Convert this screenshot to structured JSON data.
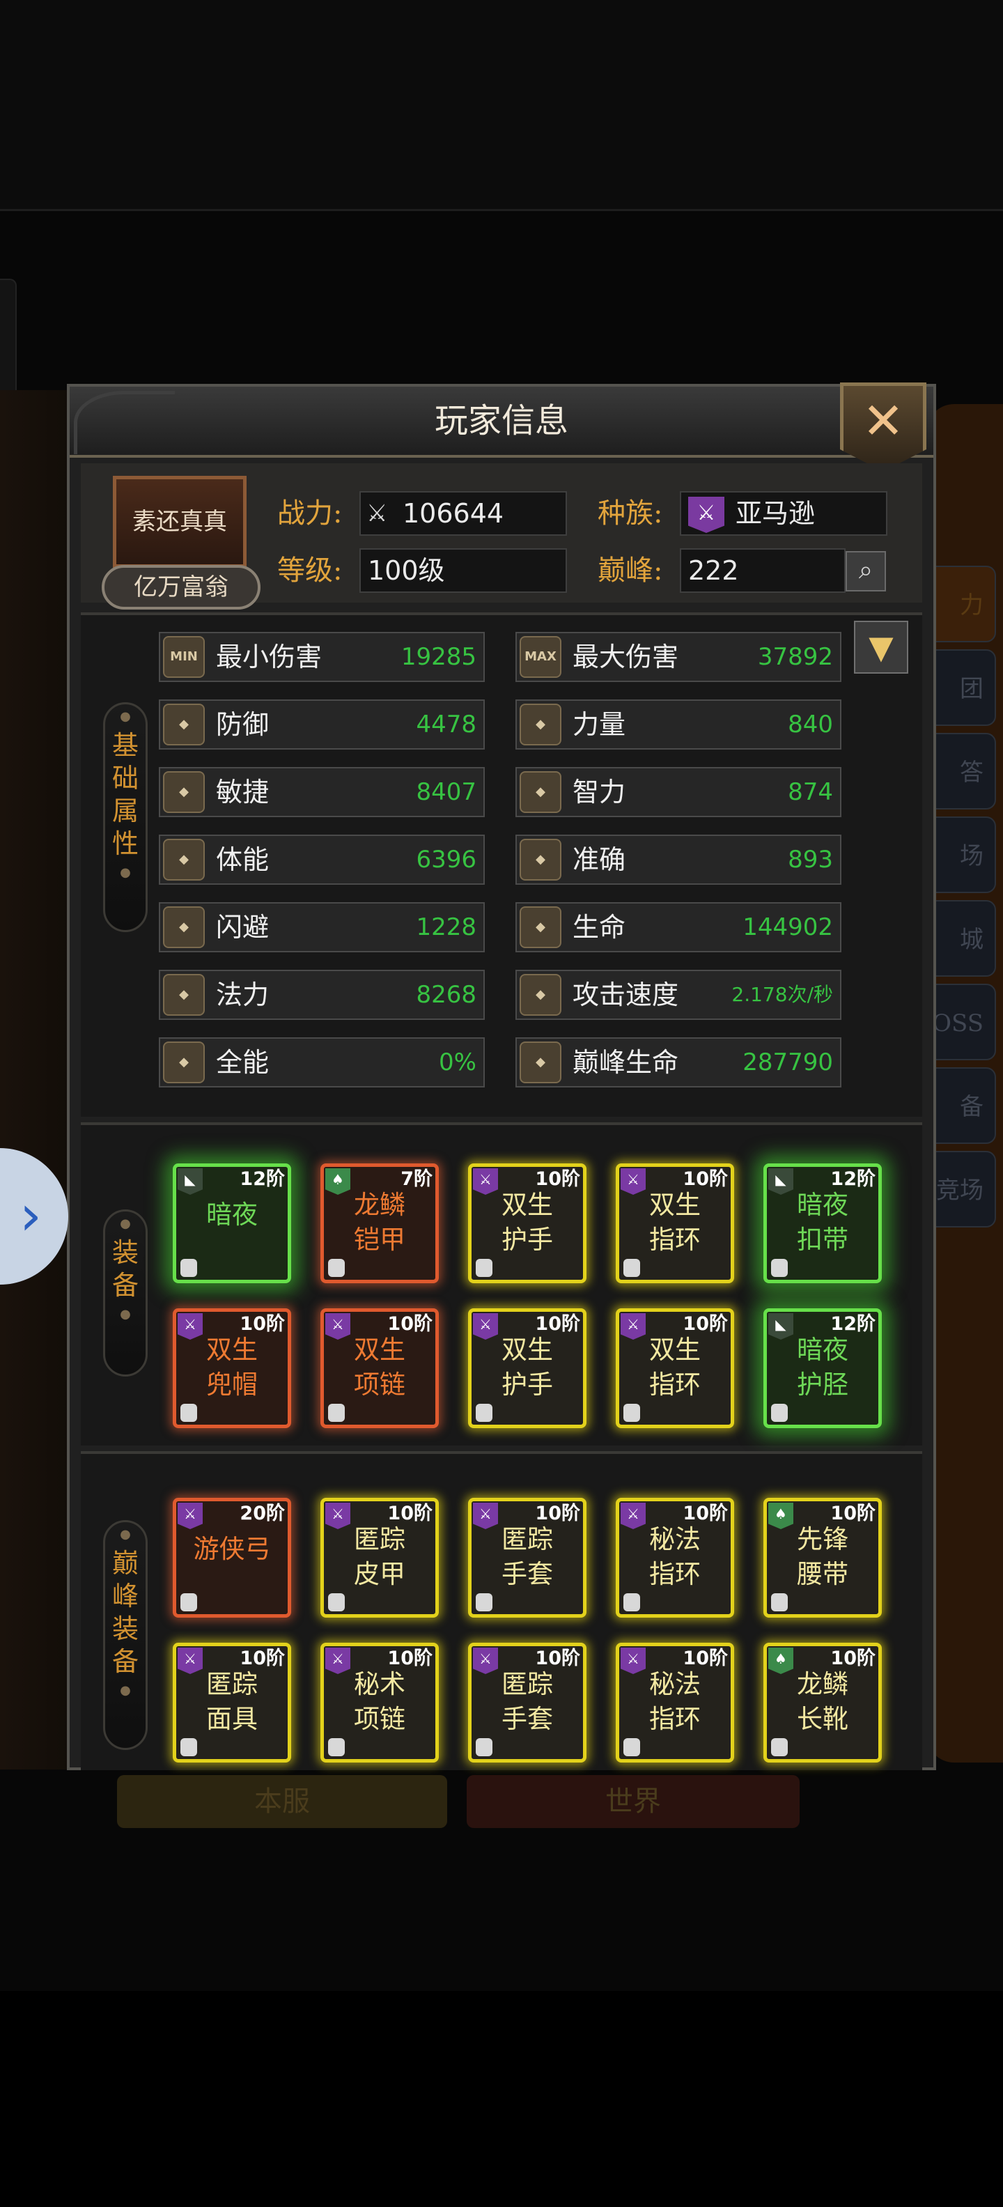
{
  "dialog": {
    "title": "玩家信息",
    "close_icon": "✕"
  },
  "player": {
    "avatar_name": "素还真真",
    "honor_title": "亿万富翁",
    "power_label": "战力:",
    "power_value": "106644",
    "level_label": "等级:",
    "level_value": "100级",
    "race_label": "种族:",
    "race_value": "亚马逊",
    "peak_label": "巅峰:",
    "peak_value": "222"
  },
  "sections": {
    "base_attrs": [
      "基",
      "础",
      "属",
      "性"
    ],
    "equipment": [
      "装",
      "备"
    ],
    "peak_equipment": [
      "巅",
      "峰",
      "装",
      "备"
    ]
  },
  "attributes": [
    {
      "name": "最小伤害",
      "value": "19285",
      "icon": "MIN"
    },
    {
      "name": "最大伤害",
      "value": "37892",
      "icon": "MAX"
    },
    {
      "name": "防御",
      "value": "4478",
      "icon": "shield-icon"
    },
    {
      "name": "力量",
      "value": "840",
      "icon": "fist-icon"
    },
    {
      "name": "敏捷",
      "value": "8407",
      "icon": "boot-icon"
    },
    {
      "name": "智力",
      "value": "874",
      "icon": "brain-icon"
    },
    {
      "name": "体能",
      "value": "6396",
      "icon": "muscle-icon"
    },
    {
      "name": "准确",
      "value": "893",
      "icon": "target-icon"
    },
    {
      "name": "闪避",
      "value": "1228",
      "icon": "dodge-icon"
    },
    {
      "name": "生命",
      "value": "144902",
      "icon": "heart-icon"
    },
    {
      "name": "法力",
      "value": "8268",
      "icon": "potion-icon"
    },
    {
      "name": "攻击速度",
      "value": "2.178次/秒",
      "icon": "speed-icon"
    },
    {
      "name": "全能",
      "value": "0%",
      "icon": "versatile-icon"
    },
    {
      "name": "巅峰生命",
      "value": "287790",
      "icon": "peak-heart-icon"
    }
  ],
  "equipment": [
    {
      "line1": "暗夜",
      "line2": "",
      "tier": "12阶",
      "quality": "green",
      "tag": "gray"
    },
    {
      "line1": "龙鳞",
      "line2": "铠甲",
      "tier": "7阶",
      "quality": "red",
      "tag": "green"
    },
    {
      "line1": "双生",
      "line2": "护手",
      "tier": "10阶",
      "quality": "yellow",
      "tag": "purple"
    },
    {
      "line1": "双生",
      "line2": "指环",
      "tier": "10阶",
      "quality": "yellow",
      "tag": "purple"
    },
    {
      "line1": "暗夜",
      "line2": "扣带",
      "tier": "12阶",
      "quality": "green",
      "tag": "gray"
    },
    {
      "line1": "双生",
      "line2": "兜帽",
      "tier": "10阶",
      "quality": "red",
      "tag": "purple"
    },
    {
      "line1": "双生",
      "line2": "项链",
      "tier": "10阶",
      "quality": "red",
      "tag": "purple"
    },
    {
      "line1": "双生",
      "line2": "护手",
      "tier": "10阶",
      "quality": "yellow",
      "tag": "purple"
    },
    {
      "line1": "双生",
      "line2": "指环",
      "tier": "10阶",
      "quality": "yellow",
      "tag": "purple"
    },
    {
      "line1": "暗夜",
      "line2": "护胫",
      "tier": "12阶",
      "quality": "green",
      "tag": "gray"
    }
  ],
  "peak_equipment": [
    {
      "line1": "游侠弓",
      "line2": "",
      "tier": "20阶",
      "quality": "red",
      "tag": "purple"
    },
    {
      "line1": "匿踪",
      "line2": "皮甲",
      "tier": "10阶",
      "quality": "yellow",
      "tag": "purple"
    },
    {
      "line1": "匿踪",
      "line2": "手套",
      "tier": "10阶",
      "quality": "yellow",
      "tag": "purple"
    },
    {
      "line1": "秘法",
      "line2": "指环",
      "tier": "10阶",
      "quality": "yellow",
      "tag": "purple"
    },
    {
      "line1": "先锋",
      "line2": "腰带",
      "tier": "10阶",
      "quality": "yellow",
      "tag": "green"
    },
    {
      "line1": "匿踪",
      "line2": "面具",
      "tier": "10阶",
      "quality": "yellow",
      "tag": "purple"
    },
    {
      "line1": "秘术",
      "line2": "项链",
      "tier": "10阶",
      "quality": "yellow",
      "tag": "purple"
    },
    {
      "line1": "匿踪",
      "line2": "手套",
      "tier": "10阶",
      "quality": "yellow",
      "tag": "purple"
    },
    {
      "line1": "秘法",
      "line2": "指环",
      "tier": "10阶",
      "quality": "yellow",
      "tag": "purple"
    },
    {
      "line1": "龙鳞",
      "line2": "长靴",
      "tier": "10阶",
      "quality": "yellow",
      "tag": "green"
    }
  ],
  "background": {
    "right_tabs": [
      "力",
      "团",
      "答",
      "场",
      "城",
      "OSS",
      "备",
      "竞场"
    ],
    "bottom_left": "本服",
    "bottom_right": "世界",
    "side_arrow": "›"
  },
  "colors": {
    "accent_gold": "#e2a43c",
    "value_green": "#37c342",
    "quality_yellow": "#e3d21b",
    "quality_red": "#e05a2e",
    "quality_green": "#67e04a"
  }
}
